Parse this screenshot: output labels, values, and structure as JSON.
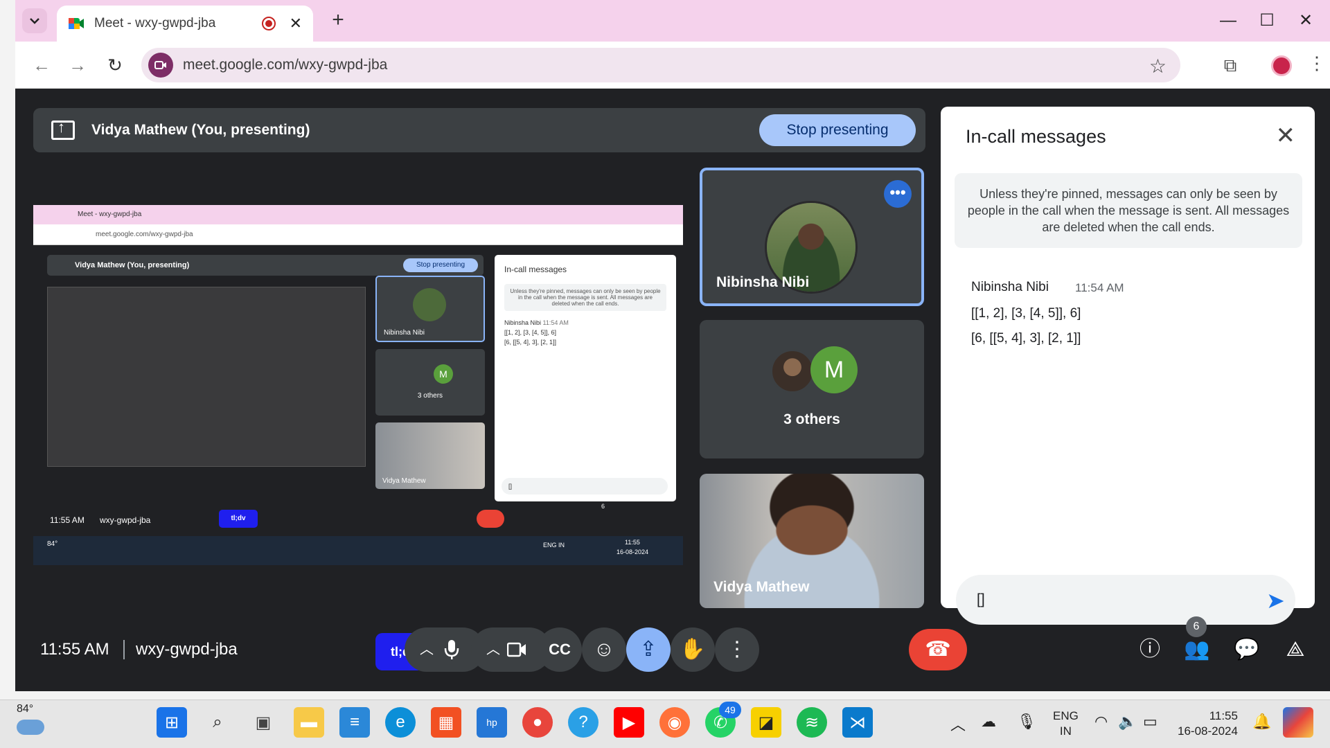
{
  "browser": {
    "tab_title": "Meet - wxy-gwpd-jba",
    "new_tab": "+",
    "tab_close": "✕",
    "minimize": "—",
    "maximize": "☐",
    "close": "✕",
    "url": "meet.google.com/wxy-gwpd-jba"
  },
  "presenting": {
    "label": "Vidya Mathew (You, presenting)",
    "stop_button": "Stop presenting"
  },
  "preview": {
    "tab_title": "Meet - wxy-gwpd-jba",
    "url": "meet.google.com/wxy-gwpd-jba",
    "presenting_label": "Vidya Mathew (You, presenting)",
    "stop_button": "Stop presenting",
    "chat_title": "In-call messages",
    "chat_note": "Unless they're pinned, messages can only be seen by people in the call when the message is sent. All messages are deleted when the call ends.",
    "msg_sender": "Nibinsha Nibi",
    "msg_time": "11:54 AM",
    "msg1": "[[1, 2], [3, [4, 5]], 6]",
    "msg2": "[6, [[5, 4], 3], [2, 1]]",
    "tile1": "Nibinsha Nibi",
    "tile2": "3 others",
    "tile2_initial": "M",
    "tile3": "Vidya Mathew",
    "clock": "11:55 AM",
    "code": "wxy-gwpd-jba",
    "tldv": "tl;dv",
    "people_count": "6",
    "input_value": "[]",
    "temp": "84°",
    "lang": "ENG\nIN",
    "time": "11:55",
    "date": "16-08-2024"
  },
  "tiles": {
    "nibinsha": "Nibinsha Nibi",
    "others": "3 others",
    "others_initial": "M",
    "more": "•••",
    "vidya": "Vidya Mathew"
  },
  "chat": {
    "title": "In-call messages",
    "note": "Unless they're pinned, messages can only be seen by people in the call when the message is sent. All messages are deleted when the call ends.",
    "sender": "Nibinsha Nibi",
    "time": "11:54 AM",
    "messages": [
      "[[1, 2], [3, [4, 5]], 6]",
      "[6, [[5, 4], 3], [2, 1]]"
    ],
    "input_value": "[]"
  },
  "controls": {
    "clock": "11:55 AM",
    "meeting_code": "wxy-gwpd-jba",
    "tldv": "tl;dv",
    "people_count": "6"
  },
  "taskbar": {
    "temperature": "84°",
    "lang_line1": "ENG",
    "lang_line2": "IN",
    "time": "11:55",
    "date": "16-08-2024",
    "whatsapp_badge": "49"
  },
  "colors": {
    "tab_strip": "#f5d2ec",
    "meet_bg": "#202124",
    "stop_button": "#a8c7fa",
    "hangup": "#ea4335",
    "tldv": "#1f1fee",
    "active_tile_border": "#8ab4f8"
  }
}
